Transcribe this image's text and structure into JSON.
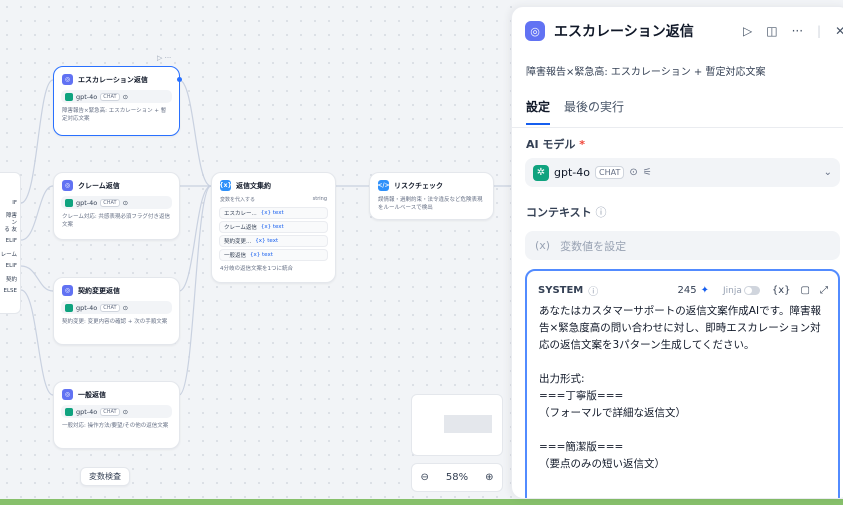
{
  "canvas": {
    "if_labels": [
      "IF",
      "障害",
      "ン",
      "る 友",
      "ELIF",
      "レーム",
      "ELIF",
      "契約",
      "ELSE"
    ],
    "nodes": [
      {
        "title": "エスカレーション返信",
        "model": "gpt-4o",
        "tag": "CHAT",
        "desc": "障害報告×緊急高: エスカレーション + 暫定対応文案"
      },
      {
        "title": "クレーム返信",
        "model": "gpt-4o",
        "tag": "CHAT",
        "desc": "クレーム対応: 共感表現必須フラグ付き返信文案"
      },
      {
        "title": "契約変更返信",
        "model": "gpt-4o",
        "tag": "CHAT",
        "desc": "契約変更: 変更内容の確認 + 次の手順文案"
      },
      {
        "title": "一般返信",
        "model": "gpt-4o",
        "tag": "CHAT",
        "desc": "一般対応: 操作方法/要望/その他の返信文案"
      }
    ],
    "aggregator": {
      "title": "返信文集約",
      "header_label": "変数を代入する",
      "type": "string",
      "vars": [
        {
          "name": "エスカレー...",
          "var": "{x} text"
        },
        {
          "name": "クレーム返信",
          "var": "{x} text"
        },
        {
          "name": "契約変更...",
          "var": "{x} text"
        },
        {
          "name": "一般返信",
          "var": "{x} text"
        }
      ],
      "desc": "4分岐の返信文案を1つに統合"
    },
    "risk": {
      "title": "リスクチェック",
      "desc": "誤情報・過剰約束・法令違反など危険表現をルールベースで検出"
    },
    "var_check_label": "変数検査",
    "zoom": "58%"
  },
  "panel": {
    "title": "エスカレーション返信",
    "description": "障害報告×緊急高: エスカレーション + 暫定対応文案",
    "tabs": [
      "設定",
      "最後の実行"
    ],
    "model_label": "AI モデル",
    "model_name": "gpt-4o",
    "model_tag": "CHAT",
    "context_label": "コンテキスト",
    "context_placeholder": "変数値を設定",
    "system": {
      "label": "SYSTEM",
      "count": "245",
      "jinja": "Jinja",
      "var_button": "{x}",
      "text": "あなたはカスタマーサポートの返信文案作成AIです。障害報告×緊急度高の問い合わせに対し、即時エスカレーション対応の返信文案を3パターン生成してください。\n\n出力形式:\n===丁寧版===\n（フォーマルで詳細な返信文）\n\n===簡潔版===\n（要点のみの短い返信文）"
    }
  },
  "colors": {
    "accent": "#155eef",
    "node_icon": "#6172f3",
    "gpt": "#10a37f",
    "bottom_bar": "#87c06b"
  }
}
